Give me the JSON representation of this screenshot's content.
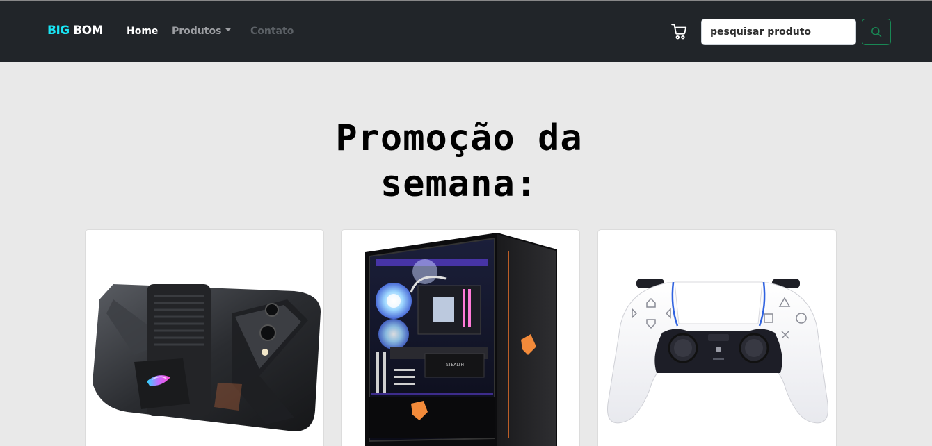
{
  "navbar": {
    "brand_part1": "BIG",
    "brand_part2": "BOM",
    "links": {
      "home": "Home",
      "produtos": "Produtos",
      "contato": "Contato"
    },
    "cart_icon": "cart-icon",
    "search": {
      "placeholder": "pesquisar produto",
      "button_icon": "search-icon"
    }
  },
  "main": {
    "title_line1": "Promoção da",
    "title_line2": "semana:"
  },
  "products": [
    {
      "image": "gaming-phone-image"
    },
    {
      "image": "gaming-pc-case-image"
    },
    {
      "image": "game-controller-image"
    }
  ],
  "colors": {
    "navbar_bg": "#212529",
    "brand_accent": "#19e6f5",
    "search_button_border": "#198754",
    "page_bg": "#e9e9e9"
  }
}
